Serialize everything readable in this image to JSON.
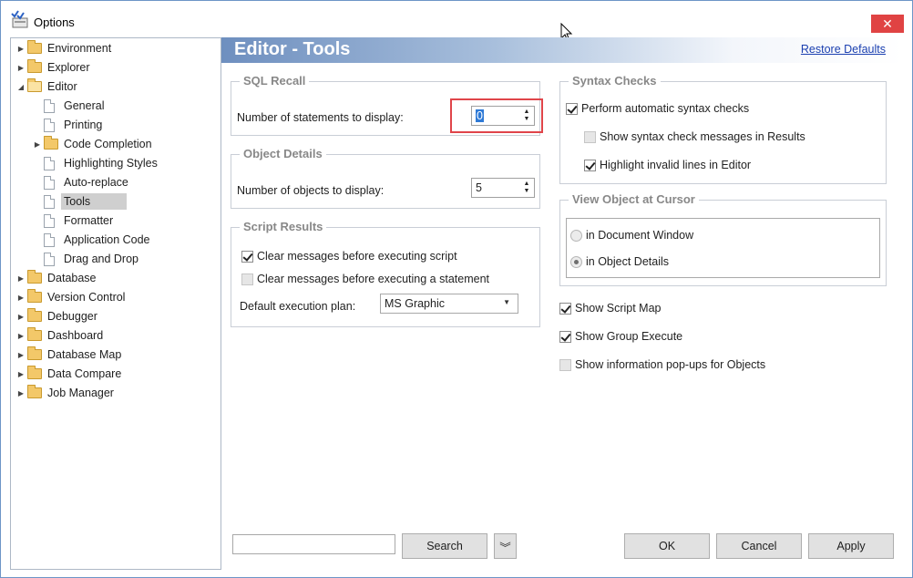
{
  "window": {
    "title": "Options",
    "close_glyph": "✕"
  },
  "tree": [
    {
      "label": "Environment",
      "kind": "folder",
      "arrow": "▶",
      "indent": 0
    },
    {
      "label": "Explorer",
      "kind": "folder",
      "arrow": "▶",
      "indent": 0
    },
    {
      "label": "Editor",
      "kind": "folder-open",
      "arrow": "◢",
      "indent": 0
    },
    {
      "label": "General",
      "kind": "page",
      "indent": 1
    },
    {
      "label": "Printing",
      "kind": "page",
      "indent": 1
    },
    {
      "label": "Code Completion",
      "kind": "folder",
      "arrow": "▶",
      "indent": 1
    },
    {
      "label": "Highlighting Styles",
      "kind": "page",
      "indent": 1
    },
    {
      "label": "Auto-replace",
      "kind": "page",
      "indent": 1
    },
    {
      "label": "Tools",
      "kind": "page",
      "indent": 1,
      "selected": true
    },
    {
      "label": "Formatter",
      "kind": "page",
      "indent": 1
    },
    {
      "label": "Application Code",
      "kind": "page",
      "indent": 1
    },
    {
      "label": "Drag and Drop",
      "kind": "page",
      "indent": 1
    },
    {
      "label": "Database",
      "kind": "folder",
      "arrow": "▶",
      "indent": 0
    },
    {
      "label": "Version Control",
      "kind": "folder",
      "arrow": "▶",
      "indent": 0
    },
    {
      "label": "Debugger",
      "kind": "folder",
      "arrow": "▶",
      "indent": 0
    },
    {
      "label": "Dashboard",
      "kind": "folder",
      "arrow": "▶",
      "indent": 0
    },
    {
      "label": "Database Map",
      "kind": "folder",
      "arrow": "▶",
      "indent": 0
    },
    {
      "label": "Data Compare",
      "kind": "folder",
      "arrow": "▶",
      "indent": 0
    },
    {
      "label": "Job Manager",
      "kind": "folder",
      "arrow": "▶",
      "indent": 0
    }
  ],
  "header": {
    "title": "Editor - Tools",
    "restore": "Restore Defaults"
  },
  "sql_recall": {
    "title": "SQL Recall",
    "statements_label": "Number of statements to display:",
    "statements_value": "0"
  },
  "object_details": {
    "title": "Object Details",
    "objects_label": "Number of objects to display:",
    "objects_value": "5"
  },
  "script_results": {
    "title": "Script Results",
    "clear_script": {
      "label": "Clear messages before executing script",
      "checked": true
    },
    "clear_statement": {
      "label": "Clear messages before executing a statement",
      "checked": false
    },
    "plan_label": "Default execution plan:",
    "plan_value": "MS Graphic"
  },
  "syntax_checks": {
    "title": "Syntax Checks",
    "perform": {
      "label": "Perform automatic syntax checks",
      "checked": true
    },
    "show_messages": {
      "label": "Show syntax check messages in Results",
      "checked": false
    },
    "highlight_invalid": {
      "label": "Highlight invalid lines in Editor",
      "checked": true
    }
  },
  "view_object": {
    "title": "View Object at Cursor",
    "doc_window": {
      "label": "in Document Window",
      "selected": false
    },
    "object_details": {
      "label": "in Object Details",
      "selected": true
    }
  },
  "options": {
    "script_map": {
      "label": "Show Script Map",
      "checked": true
    },
    "group_execute": {
      "label": "Show Group Execute",
      "checked": true
    },
    "info_popups": {
      "label": "Show information pop-ups for Objects",
      "checked": false
    }
  },
  "bottom": {
    "search_value": "",
    "search_label": "Search",
    "expand_glyph": "︾",
    "ok": "OK",
    "cancel": "Cancel",
    "apply": "Apply"
  },
  "colors": {
    "accent": "#6e8fbf",
    "highlight": "#e0454a",
    "selection": "#2f7ad6"
  }
}
